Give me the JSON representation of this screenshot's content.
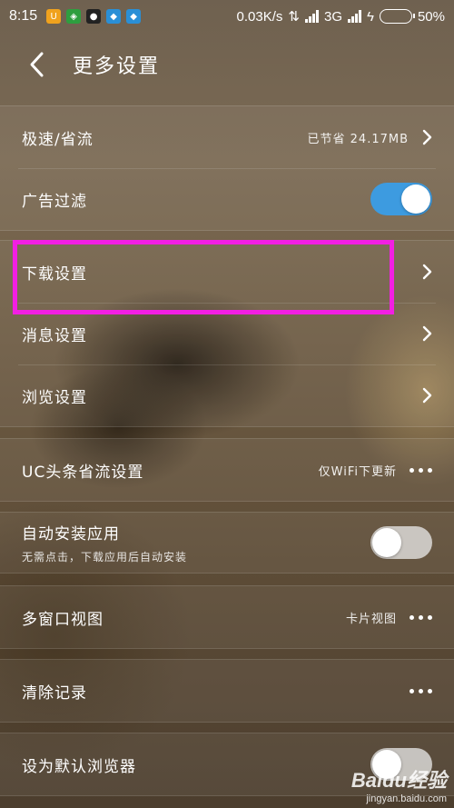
{
  "status_bar": {
    "time": "8:15",
    "speed": "0.03K/s",
    "network": "3G",
    "battery": "50%",
    "battery_level": 0.5
  },
  "header": {
    "title": "更多设置"
  },
  "groups": {
    "g1": {
      "speed_mode": {
        "label": "极速/省流",
        "value": "已节省 24.17MB"
      },
      "ad_filter": {
        "label": "广告过滤",
        "enabled": true
      }
    },
    "g2": {
      "download": {
        "label": "下载设置"
      },
      "message": {
        "label": "消息设置"
      },
      "browse": {
        "label": "浏览设置"
      }
    },
    "g3": {
      "uc_headlines": {
        "label": "UC头条省流设置",
        "value": "仅WiFi下更新"
      }
    },
    "g4": {
      "auto_install": {
        "label": "自动安装应用",
        "sub": "无需点击，下载应用后自动安装",
        "enabled": false
      }
    },
    "g5": {
      "multi_window": {
        "label": "多窗口视图",
        "value": "卡片视图"
      }
    },
    "g6": {
      "clear_history": {
        "label": "清除记录"
      }
    },
    "g7": {
      "default_browser": {
        "label": "设为默认浏览器",
        "enabled": false
      }
    }
  },
  "watermark": {
    "logo": "Baidu经验",
    "url": "jingyan.baidu.com"
  },
  "colors": {
    "toggle_on": "#3d9be0",
    "highlight": "#f21fe3"
  }
}
